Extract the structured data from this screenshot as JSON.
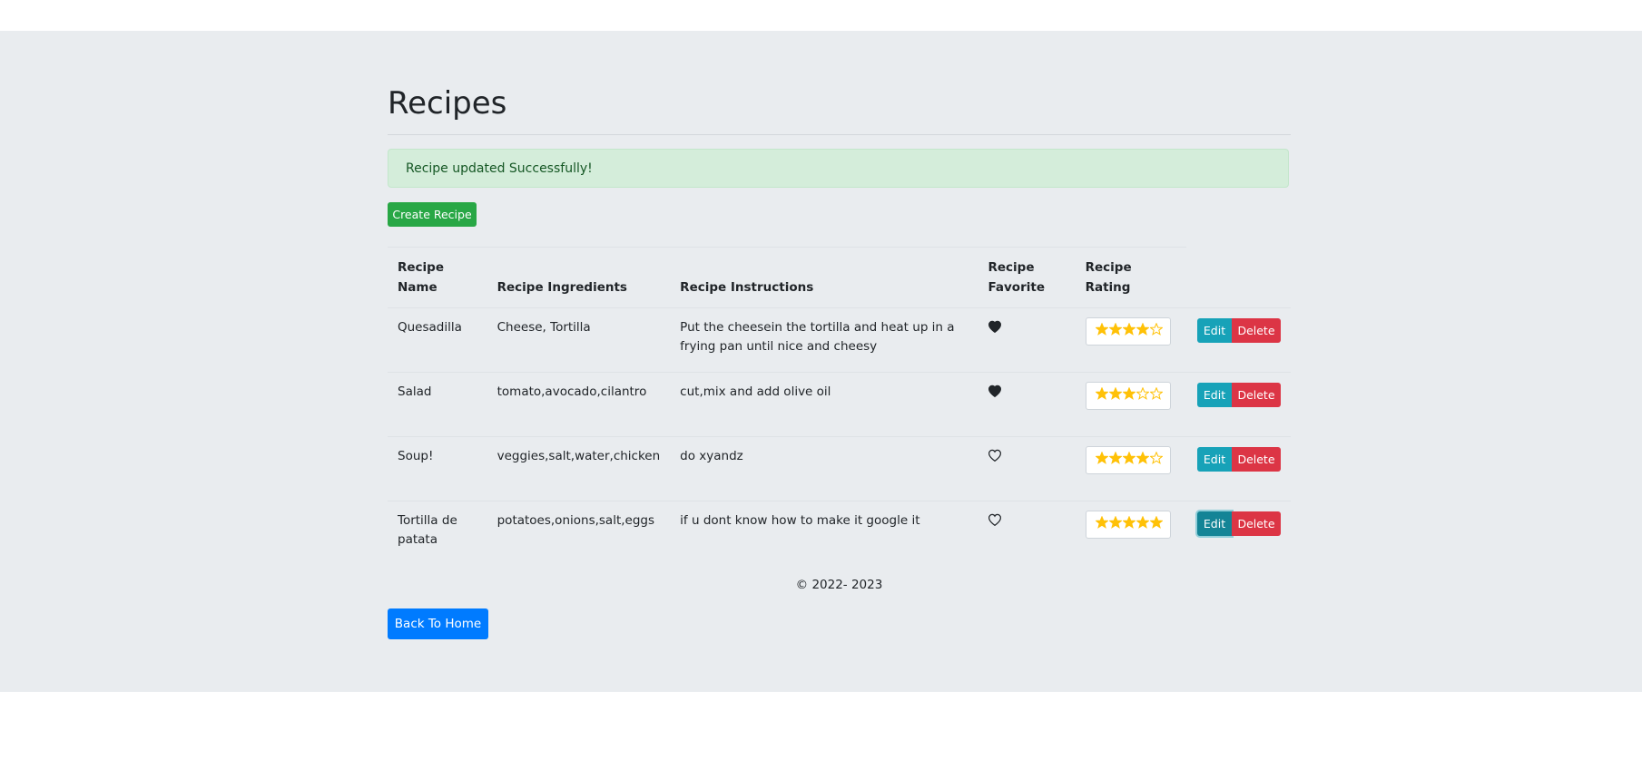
{
  "page": {
    "title": "Recipes"
  },
  "alert": {
    "message": "Recipe updated Successfully!"
  },
  "buttons": {
    "create": "Create Recipe",
    "back_home": "Back To Home",
    "edit": "Edit",
    "delete": "Delete"
  },
  "table": {
    "headers": [
      "Recipe Name",
      "Recipe Ingredients",
      "Recipe Instructions",
      "Recipe Favorite",
      "Recipe Rating"
    ],
    "rows": [
      {
        "name": "Quesadilla",
        "ingredients": "Cheese, Tortilla",
        "instructions": "Put the cheesein the tortilla and heat up in a frying pan until nice and cheesy",
        "favorite": true,
        "rating": 4
      },
      {
        "name": "Salad",
        "ingredients": "tomato,avocado,cilantro",
        "instructions": "cut,mix and add olive oil",
        "favorite": true,
        "rating": 3
      },
      {
        "name": "Soup!",
        "ingredients": "veggies,salt,water,chicken",
        "instructions": "do xyandz",
        "favorite": false,
        "rating": 4
      },
      {
        "name": "Tortilla de patata",
        "ingredients": "potatoes,onions,salt,eggs",
        "instructions": "if u dont know how to make it google it",
        "favorite": false,
        "rating": 5
      }
    ],
    "rating_max": 5
  },
  "footer": {
    "copyright": "© 2022- 2023"
  },
  "colors": {
    "star": "#ffc107",
    "heart": "#212529"
  }
}
